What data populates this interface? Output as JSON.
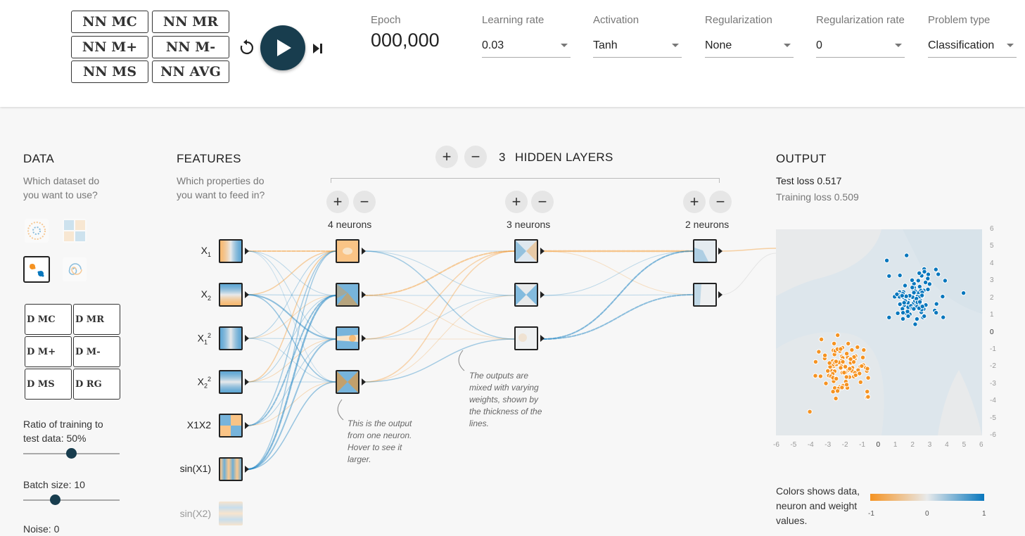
{
  "toolbar": {
    "nn_buttons": [
      "NN MC",
      "NN MR",
      "NN M+",
      "NN M-",
      "NN MS",
      "NN AVG"
    ],
    "epoch_label": "Epoch",
    "epoch_value": "000,000",
    "controls": [
      {
        "label": "Learning rate",
        "value": "0.03"
      },
      {
        "label": "Activation",
        "value": "Tanh"
      },
      {
        "label": "Regularization",
        "value": "None"
      },
      {
        "label": "Regularization rate",
        "value": "0"
      },
      {
        "label": "Problem type",
        "value": "Classification"
      }
    ],
    "icons": {
      "reset": "reset-icon",
      "play": "play-icon",
      "step": "step-icon"
    }
  },
  "data_panel": {
    "title": "DATA",
    "subtitle": "Which dataset do you want to use?",
    "selected_dataset": "gaussian",
    "dataset_buttons": [
      "D MC",
      "D MR",
      "D M+",
      "D M-",
      "D MS",
      "D RG"
    ],
    "ratio_label": "Ratio of training to test data:  50%",
    "ratio_value": 50,
    "batch_label": "Batch size:  10",
    "batch_value": 10,
    "noise_label": "Noise:  0"
  },
  "features_panel": {
    "title": "FEATURES",
    "subtitle": "Which properties do you want to feed in?",
    "features": [
      {
        "base": "X",
        "sub": "1",
        "sup": "",
        "active": true
      },
      {
        "base": "X",
        "sub": "2",
        "sup": "",
        "active": true
      },
      {
        "base": "X",
        "sub": "1",
        "sup": "2",
        "active": true
      },
      {
        "base": "X",
        "sub": "2",
        "sup": "2",
        "active": true
      },
      {
        "base": "X1X2",
        "sub": "",
        "sup": "",
        "active": true
      },
      {
        "base": "sin(X1)",
        "sub": "",
        "sup": "",
        "active": true
      },
      {
        "base": "sin(X2)",
        "sub": "",
        "sup": "",
        "active": false
      }
    ]
  },
  "network": {
    "hidden_layers_count": "3",
    "hidden_layers_label": "HIDDEN LAYERS",
    "layers": [
      {
        "neurons_label": "4 neurons",
        "count": 4
      },
      {
        "neurons_label": "3 neurons",
        "count": 3
      },
      {
        "neurons_label": "2 neurons",
        "count": 2
      }
    ],
    "annotation_neuron": "This is the output from one neuron. Hover to see it larger.",
    "annotation_weights": "The outputs are mixed with varying weights, shown by the thickness of the lines."
  },
  "output_panel": {
    "title": "OUTPUT",
    "test_loss_label": "Test loss",
    "test_loss": "0.517",
    "training_loss_label": "Training loss",
    "training_loss": "0.509",
    "axis_ticks_x": [
      "-6",
      "-5",
      "-4",
      "-3",
      "-2",
      "-1",
      "0",
      "1",
      "2",
      "3",
      "4",
      "5",
      "6"
    ],
    "axis_ticks_y": [
      "6",
      "5",
      "4",
      "3",
      "2",
      "1",
      "0",
      "-1",
      "-2",
      "-3",
      "-4",
      "-5",
      "-6"
    ],
    "legend_text": "Colors shows data, neuron and weight values.",
    "legend_ticks": [
      "-1",
      "0",
      "1"
    ],
    "colors": {
      "orange": "#f59322",
      "blue": "#0877bd",
      "neutral": "#e8eaeb"
    }
  }
}
